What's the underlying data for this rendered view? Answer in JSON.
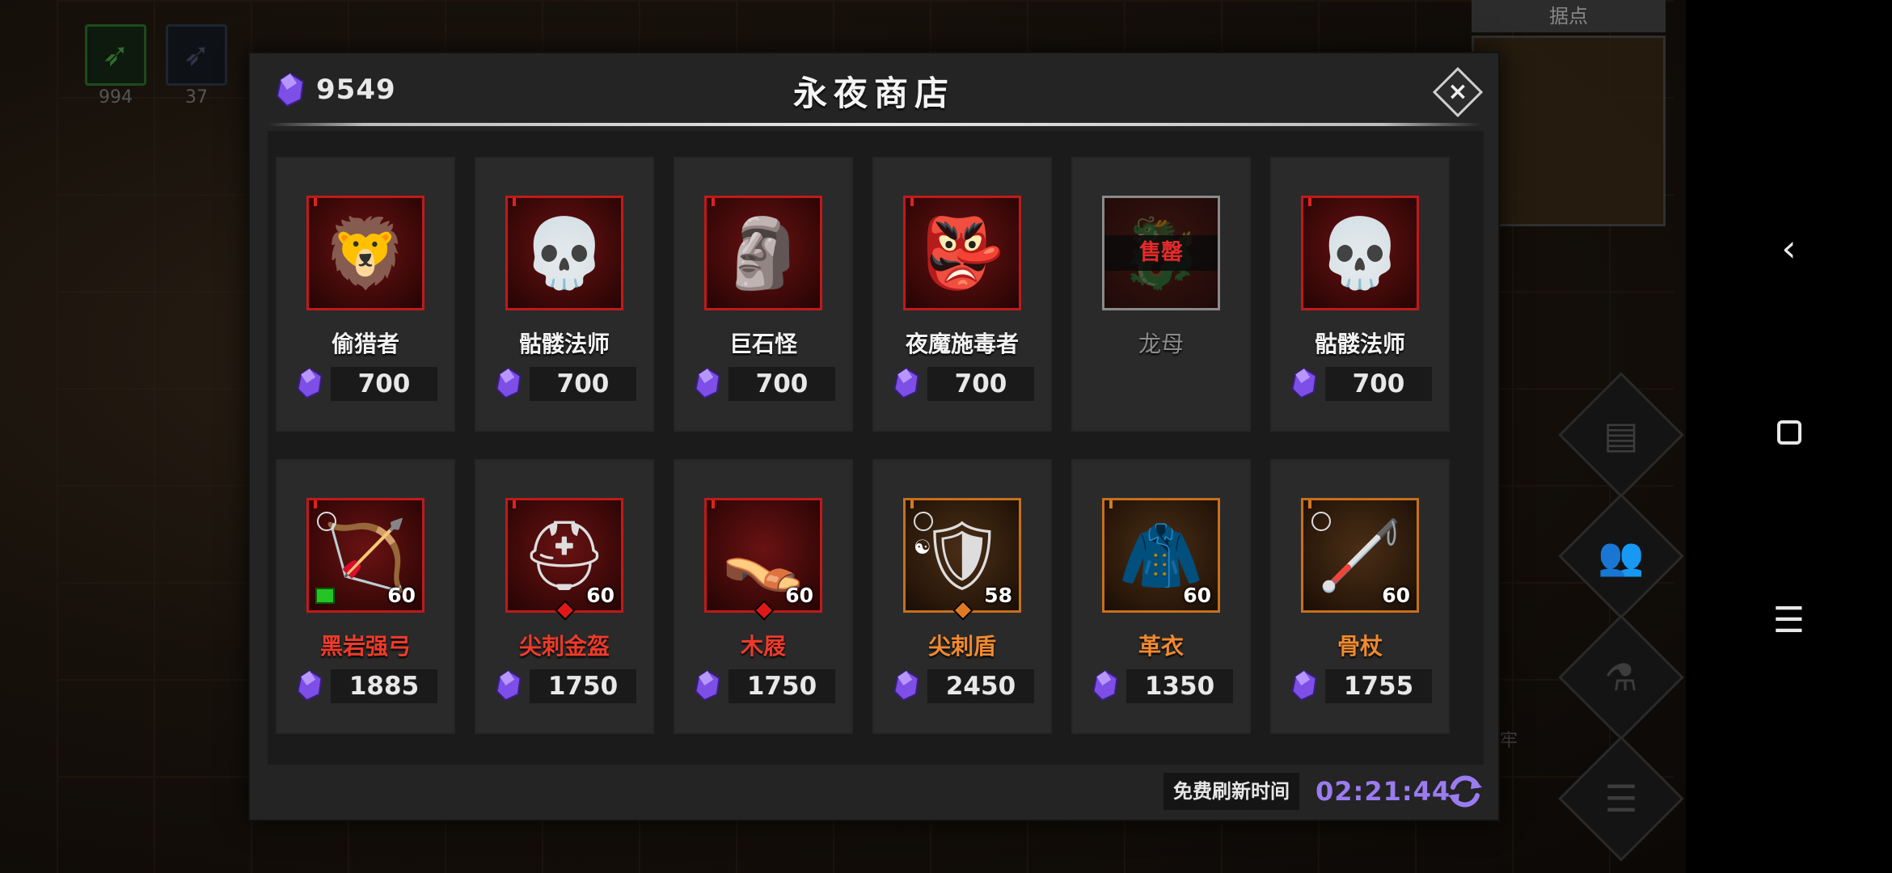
{
  "background": {
    "hud_counts": [
      "994",
      "37"
    ],
    "minimap_title": "据点",
    "faint_label": "牢"
  },
  "shop": {
    "title": "永夜商店",
    "currency_amount": "9549",
    "close_label": "×",
    "sold_out_label": "售罄",
    "refresh_label": "免费刷新时间",
    "refresh_timer": "02:21:44",
    "heroes": [
      {
        "name": "偷猎者",
        "price": "700",
        "art": "🦁"
      },
      {
        "name": "骷髅法师",
        "price": "700",
        "art": "💀"
      },
      {
        "name": "巨石怪",
        "price": "700",
        "art": "🗿"
      },
      {
        "name": "夜魔施毒者",
        "price": "700",
        "art": "👺"
      },
      {
        "name": "龙母",
        "price": "",
        "art": "🐉",
        "sold_out": true
      },
      {
        "name": "骷髅法师",
        "price": "700",
        "art": "💀"
      }
    ],
    "equipment": [
      {
        "name": "黑岩强弓",
        "price": "1885",
        "level": "60",
        "art": "🏹"
      },
      {
        "name": "尖刺金盔",
        "price": "1750",
        "level": "60",
        "art": "⛑"
      },
      {
        "name": "木屐",
        "price": "1750",
        "level": "60",
        "art": "👡"
      },
      {
        "name": "尖刺盾",
        "price": "2450",
        "level": "58",
        "art": "🛡"
      },
      {
        "name": "革衣",
        "price": "1350",
        "level": "60",
        "art": "🧥"
      },
      {
        "name": "骨杖",
        "price": "1755",
        "level": "60",
        "art": "🦯"
      }
    ]
  },
  "colors": {
    "gem": "#8a5cf0",
    "timer": "#9b7cf0",
    "rare_border": "#c01a1a",
    "epic_border": "#c5701c"
  }
}
